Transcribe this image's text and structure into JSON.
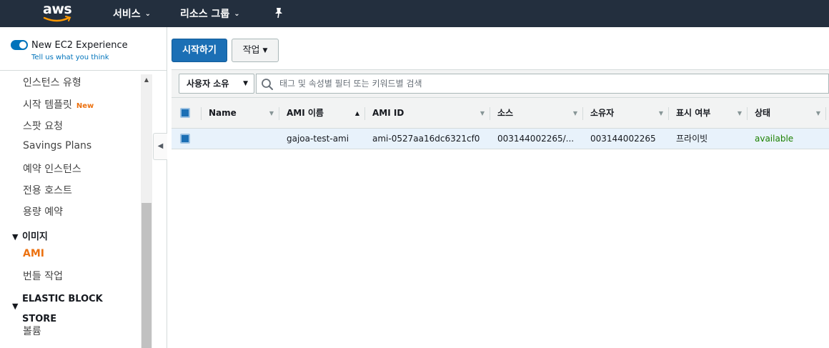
{
  "topnav": {
    "logo": "aws",
    "services": "서비스",
    "resource_groups": "리소스 그룹"
  },
  "sidebar": {
    "experience_title": "New EC2 Experience",
    "experience_sub": "Tell us what you think",
    "items": [
      {
        "label": "인스턴스 유형"
      },
      {
        "label": "시작 템플릿",
        "badge": "New"
      },
      {
        "label": "스팟 요청"
      },
      {
        "label": "Savings Plans"
      },
      {
        "label": "예약 인스턴스"
      },
      {
        "label": "전용 호스트"
      },
      {
        "label": "용량 예약"
      }
    ],
    "section_images": "이미지",
    "images_items": [
      {
        "label": "AMI",
        "active": true
      },
      {
        "label": "번들 작업"
      }
    ],
    "section_ebs_line1": "ELASTIC BLOCK",
    "section_ebs_line2": "STORE",
    "ebs_items": [
      {
        "label": "볼륨"
      }
    ]
  },
  "actions": {
    "launch": "시작하기",
    "action": "작업"
  },
  "filter": {
    "owner": "사용자 소유",
    "search_placeholder": "태그 및 속성별 필터 또는 키워드별 검색"
  },
  "table": {
    "columns": [
      "Name",
      "AMI 이름",
      "AMI ID",
      "소스",
      "소유자",
      "표시 여부",
      "상태"
    ],
    "rows": [
      {
        "name": "",
        "ami_name": "gajoa-test-ami",
        "ami_id": "ami-0527aa16dc6321cf0",
        "source": "003144002265/...",
        "owner": "003144002265",
        "visibility": "프라이빗",
        "status": "available"
      }
    ]
  },
  "colors": {
    "nav_bg": "#232f3e",
    "primary": "#1b6fb5",
    "active_orange": "#ec7211",
    "status_green": "#1d8102"
  }
}
